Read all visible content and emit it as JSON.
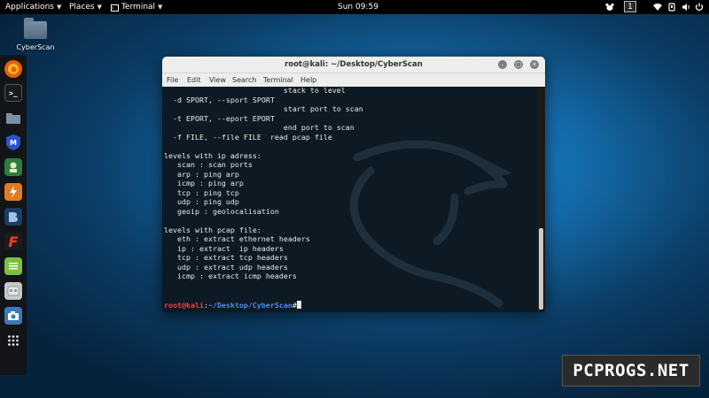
{
  "topbar": {
    "applications": "Applications",
    "places": "Places",
    "terminal": "Terminal",
    "clock": "Sun 09:59",
    "workspace": "1"
  },
  "desktop": {
    "folder_label": "CyberScan"
  },
  "dock": {
    "items": [
      {
        "icon": "firefox-icon",
        "color": "#e66000"
      },
      {
        "icon": "terminal-icon",
        "color": "#1a1a1a"
      },
      {
        "icon": "files-icon",
        "color": "#5a6f86"
      },
      {
        "icon": "metasploit-icon",
        "color": "#1f3c9c"
      },
      {
        "icon": "armitage-icon",
        "color": "#2f6d2f"
      },
      {
        "icon": "burpsuite-icon",
        "color": "#e07b22"
      },
      {
        "icon": "beef-icon",
        "color": "#2a4a73"
      },
      {
        "icon": "faraday-icon",
        "color": "#c92a1e"
      },
      {
        "icon": "leafpad-icon",
        "color": "#7cc043"
      },
      {
        "icon": "cherrytree-icon",
        "color": "#b0b0b0"
      },
      {
        "icon": "screenshot-icon",
        "color": "#3d78b8"
      },
      {
        "icon": "app-grid-icon",
        "color": "#333333"
      }
    ]
  },
  "terminal": {
    "title": "root@kali: ~/Desktop/CyberScan",
    "menu": [
      "File",
      "Edit",
      "View",
      "Search",
      "Terminal",
      "Help"
    ],
    "lines": [
      "                           stack to level",
      "  -d SPORT, --sport SPORT",
      "                           start port to scan",
      "  -t EPORT, --eport EPORT",
      "                           end port to scan",
      "  -f FILE, --file FILE  read pcap file",
      "",
      "levels with ip adress:",
      "   scan : scan ports",
      "   arp : ping arp",
      "   icmp : ping arp",
      "   tcp : ping tcp",
      "   udp : ping udp",
      "   geoip : geolocalisation",
      "",
      "levels with pcap file:",
      "   eth : extract ethernet headers",
      "   ip : extract  ip headers",
      "   tcp : extract tcp headers",
      "   udp : extract udp headers",
      "   icmp : extract icmp headers"
    ],
    "prompt_user": "root@kali",
    "prompt_sep": ":",
    "prompt_path": "~/Desktop/CyberScan",
    "prompt_symbol": "#"
  },
  "watermark": "PCPROGS.NET"
}
